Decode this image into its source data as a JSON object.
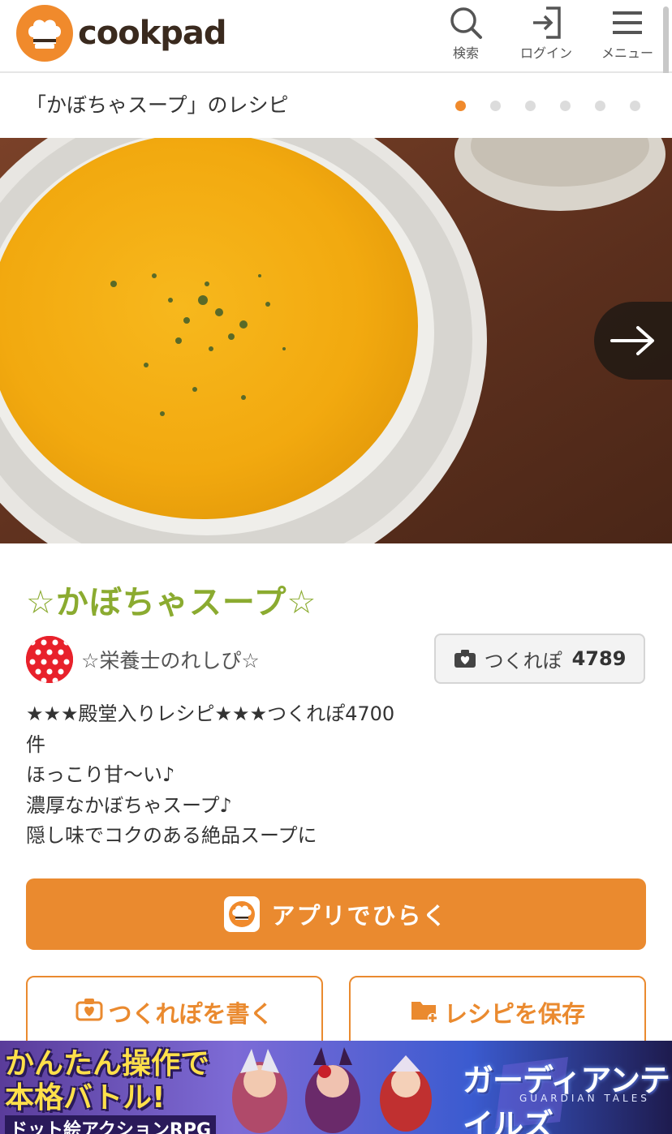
{
  "header": {
    "logo_text": "cookpad",
    "search_label": "検索",
    "login_label": "ログイン",
    "menu_label": "メニュー"
  },
  "subheader": {
    "title": "「かぼちゃスープ」のレシピ",
    "slide_count": 6,
    "active_slide": 1
  },
  "recipe": {
    "title": "☆かぼちゃスープ☆",
    "author": "☆栄養士のれしぴ☆",
    "tsukurepo_label": "つくれぽ",
    "tsukurepo_count": "4789",
    "description": [
      "★★★殿堂入りレシピ★★★つくれぽ4700",
      "件",
      "ほっこり甘〜い♪",
      "濃厚なかぼちゃスープ♪",
      "隠し味でコクのある絶品スープに"
    ]
  },
  "actions": {
    "open_app_label": "アプリでひらく",
    "write_tsukurepo_label": "つくれぽを書く",
    "save_recipe_label": "レシピを保存"
  },
  "ad": {
    "headline_line1": "かんたん操作で",
    "headline_line2": "本格バトル!",
    "subline": "ドット絵アクションRPG",
    "game_logo": "ガーディアンテイルズ",
    "game_logo_sub": "GUARDIAN TALES"
  },
  "colors": {
    "brand_orange": "#ea8a2f",
    "title_green": "#8bab30",
    "dot_inactive": "#dcdcdc"
  }
}
